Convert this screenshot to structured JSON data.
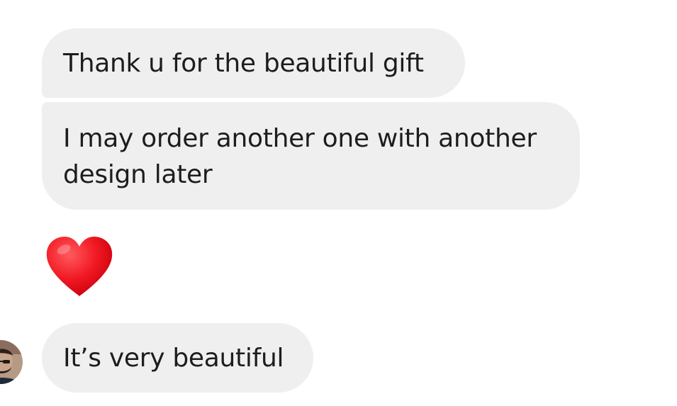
{
  "conversation": {
    "messages": [
      {
        "text": "Thank u for the beautiful gift"
      },
      {
        "text": "I may order another one with another design later"
      },
      {
        "emoji": "red-heart"
      },
      {
        "text": "It’s very beautiful"
      }
    ]
  },
  "colors": {
    "bubble_bg": "#efefef",
    "text": "#1d1d1d",
    "heart": "#e8141f"
  },
  "avatar": {
    "icon": "user-avatar"
  }
}
